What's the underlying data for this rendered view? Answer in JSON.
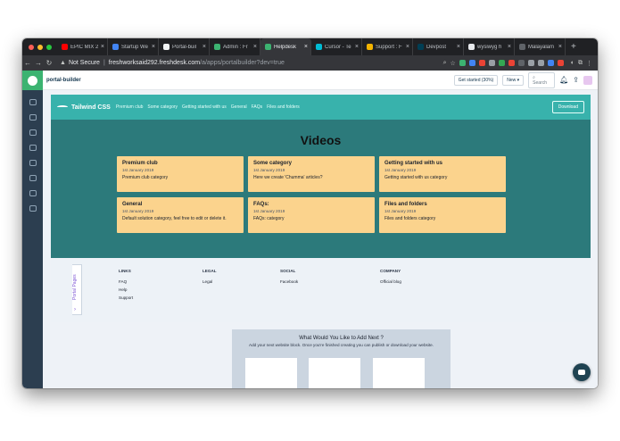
{
  "browser": {
    "tabs": [
      {
        "label": "EPIC MIX 2",
        "color": "#ff0000"
      },
      {
        "label": "Startup We",
        "color": "#4285f4"
      },
      {
        "label": "Portal-buil",
        "color": "#f1f3f4"
      },
      {
        "label": "Admin : Fr",
        "color": "#3cb371"
      },
      {
        "label": "Helpdesk",
        "color": "#3cb371"
      },
      {
        "label": "Cursor - Te",
        "color": "#00bcd4"
      },
      {
        "label": "Support : F",
        "color": "#f4b400"
      },
      {
        "label": "Devpost",
        "color": "#003e54"
      },
      {
        "label": "wysiwyg h",
        "color": "#e8eaed"
      },
      {
        "label": "Malayalam",
        "color": "#5f6368"
      }
    ],
    "active_tab_index": 4,
    "address": {
      "security": "Not Secure",
      "host": "freshworksaid292.freshdesk.com",
      "path": "/a/apps/portalbuilder?dev=true"
    }
  },
  "app": {
    "title": "portal-builder",
    "get_started": "Get started (30%)",
    "new_label": "New",
    "search_placeholder": "Search"
  },
  "site": {
    "brand": "Tailwind CSS",
    "nav": [
      "Premium club",
      "Some category",
      "Getting started with us",
      "General",
      "FAQs",
      "Files and folders"
    ],
    "download": "Download",
    "heading": "Videos",
    "cards": [
      {
        "title": "Premium club",
        "date": "1st January 2019",
        "desc": "Premium club category"
      },
      {
        "title": "Some category",
        "date": "1st January 2019",
        "desc": "Here we create 'Chumma' articles?"
      },
      {
        "title": "Getting started with us",
        "date": "1st January 2019",
        "desc": "Getting started with us category"
      },
      {
        "title": "General",
        "date": "1st January 2019",
        "desc": "Default solution category, feel free to edit or delete it."
      },
      {
        "title": "FAQs:",
        "date": "1st January 2019",
        "desc": "FAQs: category"
      },
      {
        "title": "Files and folders",
        "date": "1st January 2019",
        "desc": "Files and folders category"
      }
    ],
    "footer": [
      {
        "heading": "LINKS",
        "links": [
          "FAQ",
          "Help",
          "Support"
        ]
      },
      {
        "heading": "LEGAL",
        "links": [
          "Legal"
        ]
      },
      {
        "heading": "SOCIAL",
        "links": [
          "Facebook"
        ]
      },
      {
        "heading": "COMPANY",
        "links": [
          "Official blog"
        ]
      }
    ]
  },
  "portal_pages": "Portal Pages",
  "add_next": {
    "title": "What Would You Like to Add Next ?",
    "subtitle": "Add your next website block. Once you're finished creating you can publish or download your website."
  }
}
